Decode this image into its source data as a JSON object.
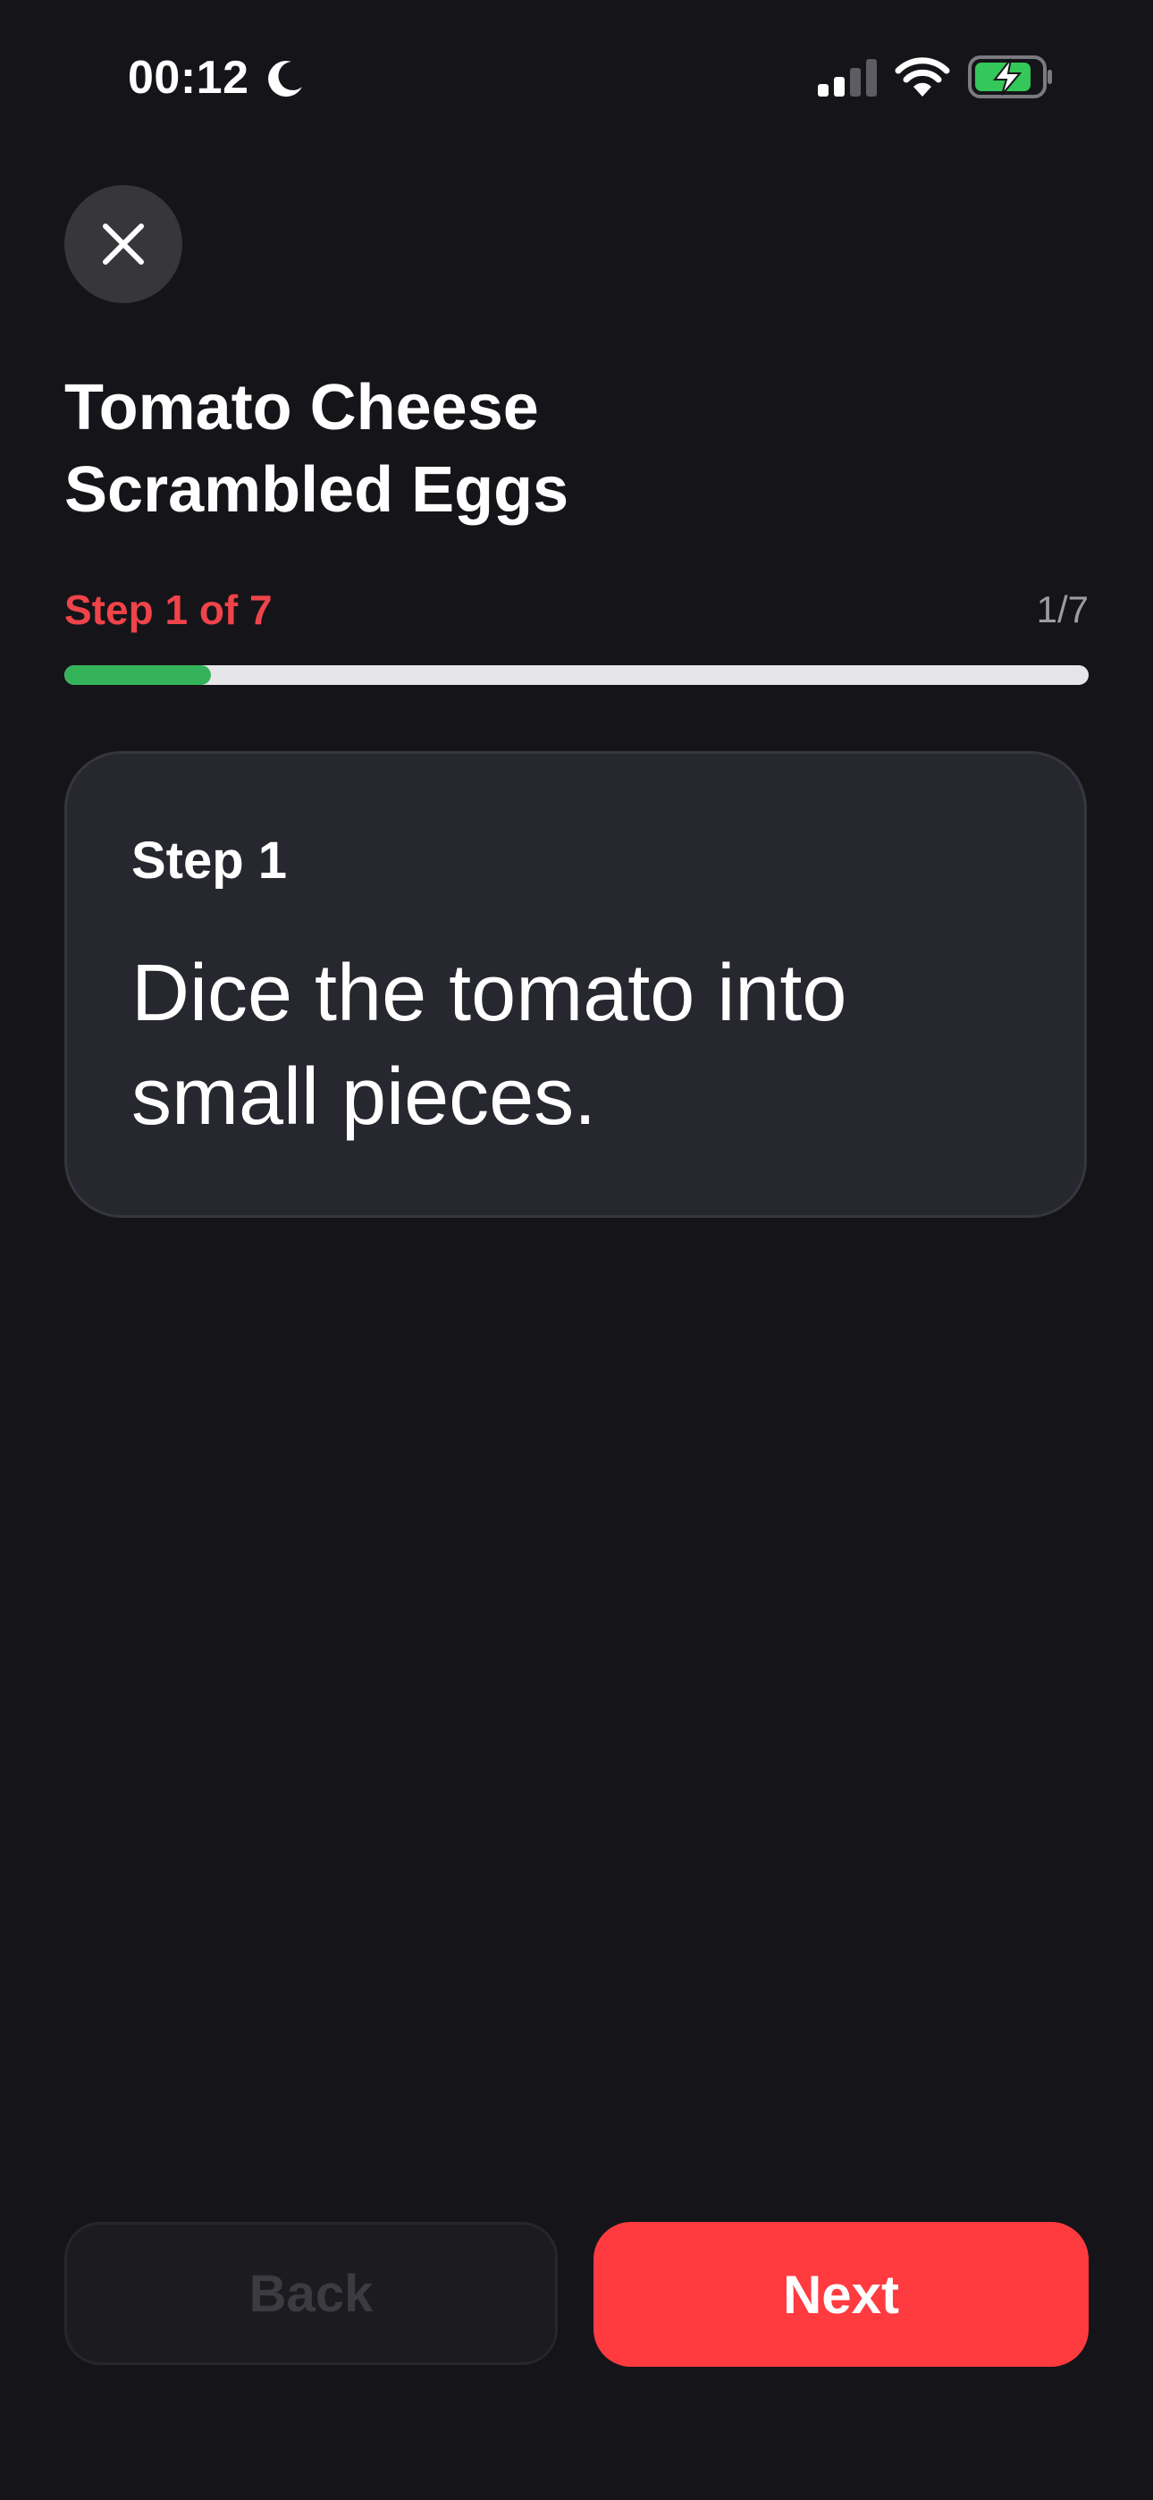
{
  "status_bar": {
    "time": "00:12",
    "icons": [
      "moon-icon",
      "cellular-signal-icon",
      "wifi-icon",
      "battery-charging-icon"
    ]
  },
  "header": {
    "close_icon": "close-icon",
    "title_line1": "Tomato Cheese",
    "title_line2": "Scrambled Eggs"
  },
  "progress": {
    "step_label": "Step 1 of 7",
    "counter": "1/7",
    "fraction": 0.1429,
    "fill_color": "#34b35a",
    "label_color": "#f0434a"
  },
  "step_card": {
    "label": "Step 1",
    "instruction": "Dice the tomato into small pieces."
  },
  "footer": {
    "back_label": "Back",
    "back_disabled": true,
    "next_label": "Next",
    "next_color": "#ff3b40"
  }
}
